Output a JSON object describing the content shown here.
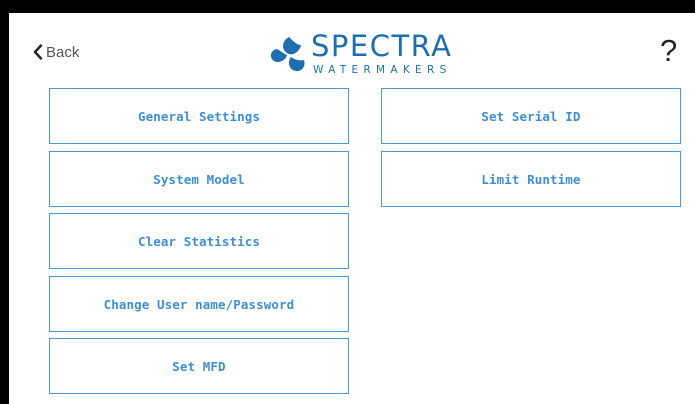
{
  "header": {
    "back_label": "Back",
    "logo_word": "SPECTRA",
    "logo_sub": "WATERMAKERS",
    "help_label": "?"
  },
  "colors": {
    "accent": "#3f8fd0",
    "border": "#4a9ad4",
    "brand": "#1f6fb0"
  },
  "buttons_left": [
    "General Settings",
    "System Model",
    "Clear Statistics",
    "Change User name/Password",
    "Set MFD"
  ],
  "buttons_right": [
    "Set Serial ID",
    "Limit Runtime"
  ]
}
